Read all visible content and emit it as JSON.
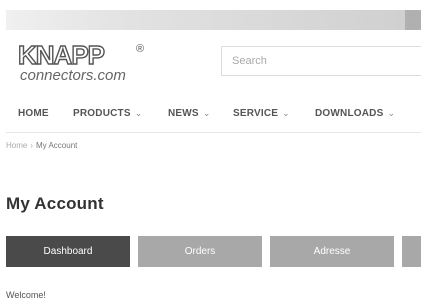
{
  "logo": {
    "word": "KNAPP",
    "registered": "®",
    "sub": "connectors.com"
  },
  "search": {
    "placeholder": "Search"
  },
  "nav": {
    "items": [
      {
        "label": "HOME",
        "chevron": ""
      },
      {
        "label": "PRODUCTS",
        "chevron": "⌄"
      },
      {
        "label": "NEWS",
        "chevron": "⌄"
      },
      {
        "label": "SERVICE",
        "chevron": "⌄"
      },
      {
        "label": "DOWNLOADS",
        "chevron": "⌄"
      }
    ]
  },
  "breadcrumb": {
    "home": "Home",
    "separator": "›",
    "current": "My Account"
  },
  "page": {
    "title": "My Account",
    "welcome": "Welcome!"
  },
  "tabs": [
    {
      "label": "Dashboard",
      "active": true
    },
    {
      "label": "Orders",
      "active": false
    },
    {
      "label": "Adresse",
      "active": false
    },
    {
      "label": "",
      "active": false
    }
  ]
}
